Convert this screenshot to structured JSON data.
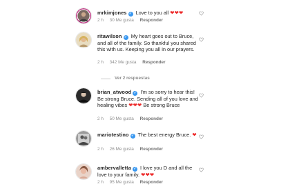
{
  "comments": [
    {
      "username": "mrkimjones",
      "text": "Love to you all",
      "hearts": "❤❤❤",
      "time": "2 h",
      "likes": "30 Me gusta",
      "reply": "Responder"
    },
    {
      "username": "ritawilson",
      "text": "My heart goes out to Bruce, and all of the family. So thankful you shared this with us. Keeping you all in our prayers.",
      "hearts": "",
      "time": "2 h",
      "likes": "342 Me gusta",
      "reply": "Responder"
    },
    {
      "username": "brian_atwood",
      "text": "I'm so sorry to hear this! Be strong Bruce. Sending all of you love and healing vibes",
      "hearts": "❤❤❤",
      "text_after": "Be strong Bruce",
      "time": "2 h",
      "likes": "50 Me gusta",
      "reply": "Responder"
    },
    {
      "username": "mariotestino",
      "text": "The best energy Bruce.",
      "hearts": "❤",
      "time": "2 h",
      "likes": "26 Me gusta",
      "reply": "Responder"
    },
    {
      "username": "ambervalletta",
      "text": "I love you D and all the love to your family.",
      "hearts": "❤❤❤",
      "time": "2 h",
      "likes": "95 Me gusta",
      "reply": "Responder"
    }
  ],
  "view_replies": "Ver 2 respuestas",
  "verified_mark": "✓",
  "colors": {
    "heart": "#ed2a2a",
    "verified": "#3897f0",
    "meta": "#8e8e8e"
  },
  "icons": {
    "like": "heart-outline-icon"
  }
}
